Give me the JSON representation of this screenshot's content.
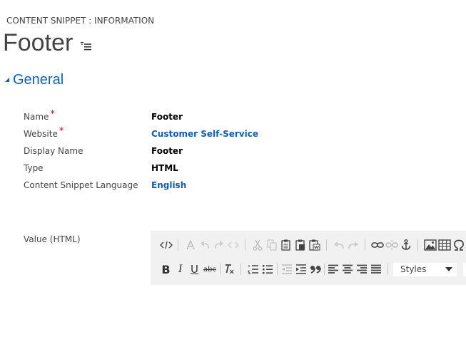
{
  "header": {
    "entity_type": "CONTENT SNIPPET : INFORMATION",
    "record_title": "Footer"
  },
  "section": {
    "title": "General"
  },
  "fields": [
    {
      "label": "Name",
      "required": true,
      "value": "Footer",
      "is_link": false
    },
    {
      "label": "Website",
      "required": true,
      "value": "Customer Self-Service",
      "is_link": true
    },
    {
      "label": "Display Name",
      "required": false,
      "value": "Footer",
      "is_link": false
    },
    {
      "label": "Type",
      "required": false,
      "value": "HTML",
      "is_link": false
    },
    {
      "label": "Content Snippet Language",
      "required": false,
      "value": "English",
      "is_link": true
    }
  ],
  "required_marker": "*",
  "value_field": {
    "label": "Value (HTML)"
  },
  "editor_toolbar": {
    "row1_icons": [
      "source-code",
      "insert-text",
      "undo-format",
      "redo-format",
      "code-tag",
      "cut",
      "copy",
      "paste",
      "paste-text",
      "paste-word",
      "undo",
      "redo",
      "link",
      "unlink",
      "anchor",
      "image",
      "table",
      "special-char"
    ],
    "row2_icons": [
      "bold",
      "italic",
      "underline",
      "strikethrough",
      "remove-format",
      "numbered-list",
      "bulleted-list",
      "decrease-indent",
      "increase-indent",
      "blockquote",
      "align-left",
      "align-center",
      "align-right",
      "justify"
    ],
    "bold_glyph": "B",
    "italic_glyph": "I",
    "underline_glyph": "U",
    "strike_glyph": "abc",
    "styles_select_value": "Styles"
  },
  "colors": {
    "accent_link": "#1160b7",
    "required": "#d0021b",
    "editor_bg": "#f1f1f1"
  }
}
